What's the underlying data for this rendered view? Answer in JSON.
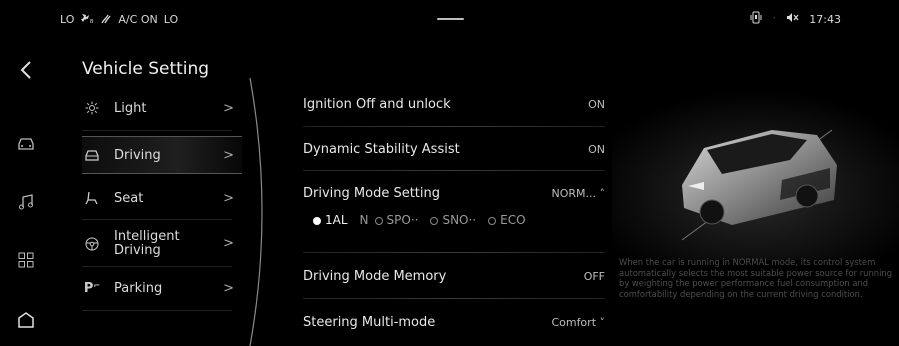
{
  "status": {
    "left_ac_temp_left": "LO",
    "ac_status": "A/C ON",
    "left_ac_temp_right": "LO",
    "time": "17:43",
    "volume_label": "✕"
  },
  "rail": {
    "icons": [
      "back-icon",
      "car-icon",
      "music-icon",
      "apps-icon",
      "home-icon"
    ]
  },
  "page_title": "Vehicle Setting",
  "categories": [
    {
      "label": "Light",
      "icon": "light-icon",
      "arrow": ">"
    },
    {
      "label": "Driving",
      "icon": "car-icon",
      "arrow": ">"
    },
    {
      "label": "Seat",
      "icon": "seat-icon",
      "arrow": ">"
    },
    {
      "label": "Intelligent\nDriving",
      "label_line1": "Intelligent",
      "label_line2": "Driving",
      "icon": "steering-icon",
      "arrow": ">"
    },
    {
      "label": "Parking",
      "icon": "parking-icon",
      "arrow": ">"
    }
  ],
  "settings": [
    {
      "label": "Ignition Off and unlock",
      "value": "ON"
    },
    {
      "label": "Dynamic Stability Assist",
      "value": "ON"
    },
    {
      "label": "Driving Mode Setting",
      "value": "NORM... ˄"
    },
    {
      "label": "Driving Mode Memory",
      "value": "OFF"
    },
    {
      "label": "Steering Multi-mode",
      "value": "Comfort ˅"
    }
  ],
  "modes": [
    {
      "label": "1AL",
      "selected": true
    },
    {
      "label": "SPO··",
      "selected": false
    },
    {
      "label": "SNO··",
      "selected": false
    },
    {
      "label": "ECO",
      "selected": false
    }
  ],
  "mode_partial_prefix": "N",
  "description": "When the car is running in NORMAL mode, its control system automatically selects the most suitable power source for running by weighting the power performance fuel consumption and comfortability depending on the current driving condition."
}
